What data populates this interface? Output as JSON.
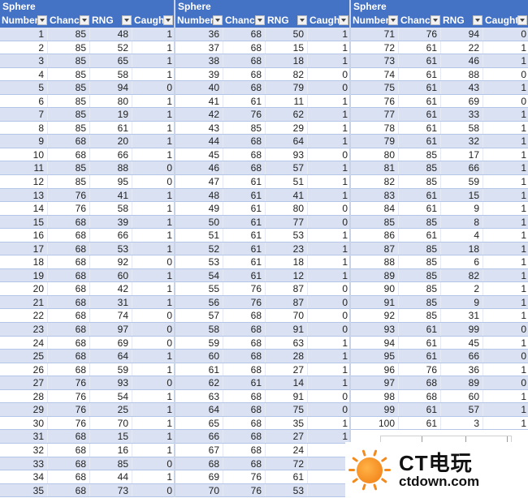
{
  "table": {
    "group_header": "Sphere",
    "columns": [
      "Number",
      "Chance",
      "RNG",
      "Caught"
    ],
    "rows": [
      [
        1,
        85,
        48,
        1
      ],
      [
        2,
        85,
        52,
        1
      ],
      [
        3,
        85,
        65,
        1
      ],
      [
        4,
        85,
        58,
        1
      ],
      [
        5,
        85,
        94,
        0
      ],
      [
        6,
        85,
        80,
        1
      ],
      [
        7,
        85,
        19,
        1
      ],
      [
        8,
        85,
        61,
        1
      ],
      [
        9,
        68,
        20,
        1
      ],
      [
        10,
        68,
        66,
        1
      ],
      [
        11,
        85,
        88,
        0
      ],
      [
        12,
        85,
        95,
        0
      ],
      [
        13,
        76,
        41,
        1
      ],
      [
        14,
        76,
        58,
        1
      ],
      [
        15,
        68,
        39,
        1
      ],
      [
        16,
        68,
        66,
        1
      ],
      [
        17,
        68,
        53,
        1
      ],
      [
        18,
        68,
        92,
        0
      ],
      [
        19,
        68,
        60,
        1
      ],
      [
        20,
        68,
        42,
        1
      ],
      [
        21,
        68,
        31,
        1
      ],
      [
        22,
        68,
        74,
        0
      ],
      [
        23,
        68,
        97,
        0
      ],
      [
        24,
        68,
        69,
        0
      ],
      [
        25,
        68,
        64,
        1
      ],
      [
        26,
        68,
        59,
        1
      ],
      [
        27,
        76,
        93,
        0
      ],
      [
        28,
        76,
        54,
        1
      ],
      [
        29,
        76,
        25,
        1
      ],
      [
        30,
        76,
        70,
        1
      ],
      [
        31,
        68,
        15,
        1
      ],
      [
        32,
        68,
        16,
        1
      ],
      [
        33,
        68,
        85,
        0
      ],
      [
        34,
        68,
        44,
        1
      ],
      [
        35,
        68,
        73,
        0
      ],
      [
        36,
        68,
        50,
        1
      ],
      [
        37,
        68,
        15,
        1
      ],
      [
        38,
        68,
        18,
        1
      ],
      [
        39,
        68,
        82,
        0
      ],
      [
        40,
        68,
        79,
        0
      ],
      [
        41,
        61,
        11,
        1
      ],
      [
        42,
        76,
        62,
        1
      ],
      [
        43,
        85,
        29,
        1
      ],
      [
        44,
        68,
        64,
        1
      ],
      [
        45,
        68,
        93,
        0
      ],
      [
        46,
        68,
        57,
        1
      ],
      [
        47,
        61,
        51,
        1
      ],
      [
        48,
        61,
        41,
        1
      ],
      [
        49,
        61,
        80,
        0
      ],
      [
        50,
        61,
        77,
        0
      ],
      [
        51,
        61,
        53,
        1
      ],
      [
        52,
        61,
        23,
        1
      ],
      [
        53,
        61,
        18,
        1
      ],
      [
        54,
        61,
        12,
        1
      ],
      [
        55,
        76,
        87,
        0
      ],
      [
        56,
        76,
        87,
        0
      ],
      [
        57,
        68,
        70,
        0
      ],
      [
        58,
        68,
        91,
        0
      ],
      [
        59,
        68,
        63,
        1
      ],
      [
        60,
        68,
        28,
        1
      ],
      [
        61,
        68,
        27,
        1
      ],
      [
        62,
        61,
        14,
        1
      ],
      [
        63,
        68,
        91,
        0
      ],
      [
        64,
        68,
        75,
        0
      ],
      [
        65,
        68,
        35,
        1
      ],
      [
        66,
        68,
        27,
        1
      ],
      [
        67,
        68,
        24,
        null
      ],
      [
        68,
        68,
        72,
        null
      ],
      [
        69,
        76,
        61,
        null
      ],
      [
        70,
        76,
        53,
        null
      ],
      [
        71,
        76,
        94,
        0
      ],
      [
        72,
        61,
        22,
        1
      ],
      [
        73,
        61,
        46,
        1
      ],
      [
        74,
        61,
        88,
        0
      ],
      [
        75,
        61,
        43,
        1
      ],
      [
        76,
        61,
        69,
        0
      ],
      [
        77,
        61,
        33,
        1
      ],
      [
        78,
        61,
        58,
        1
      ],
      [
        79,
        61,
        32,
        1
      ],
      [
        80,
        85,
        17,
        1
      ],
      [
        81,
        85,
        66,
        1
      ],
      [
        82,
        85,
        59,
        1
      ],
      [
        83,
        61,
        15,
        1
      ],
      [
        84,
        61,
        9,
        1
      ],
      [
        85,
        85,
        8,
        1
      ],
      [
        86,
        61,
        4,
        1
      ],
      [
        87,
        85,
        18,
        1
      ],
      [
        88,
        85,
        6,
        1
      ],
      [
        89,
        85,
        82,
        1
      ],
      [
        90,
        85,
        2,
        1
      ],
      [
        91,
        85,
        9,
        1
      ],
      [
        92,
        85,
        31,
        1
      ],
      [
        93,
        61,
        99,
        0
      ],
      [
        94,
        61,
        45,
        1
      ],
      [
        95,
        61,
        66,
        0
      ],
      [
        96,
        76,
        36,
        1
      ],
      [
        97,
        68,
        89,
        0
      ],
      [
        98,
        68,
        60,
        1
      ],
      [
        99,
        61,
        57,
        1
      ],
      [
        100,
        61,
        3,
        1
      ]
    ]
  },
  "watermark": {
    "title": "CT电玩",
    "url": "ctdown.com",
    "icon": "sun-logo-icon",
    "color": "#f07a10"
  },
  "colors": {
    "header_bg": "#4472c4",
    "band_bg": "#d9e1f2",
    "border": "#b4c6e7"
  }
}
